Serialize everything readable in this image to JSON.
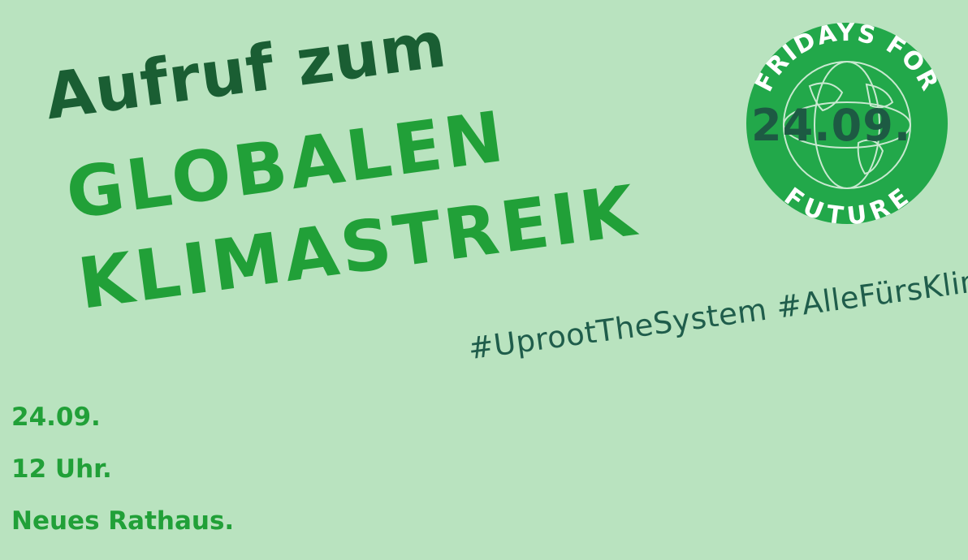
{
  "headline": {
    "line1": "Aufruf zum",
    "line2": "GLOBALEN",
    "line3": "KLIMASTREIK"
  },
  "hashtags": "#UprootTheSystem #AlleFürsKlima",
  "event": {
    "date": "24.09.",
    "time": "12 Uhr.",
    "place": "Neues Rathaus."
  },
  "logo": {
    "top_text": "FRIDAYS FOR",
    "bottom_text": "FUTURE",
    "overlay_date": "24.09.",
    "icon": "fridays-for-future-globe-icon"
  },
  "colors": {
    "background": "#b9e3bf",
    "dark_green": "#1a5e33",
    "bright_green": "#21a038",
    "teal": "#1f5d4b",
    "logo_green": "#22a84a"
  }
}
